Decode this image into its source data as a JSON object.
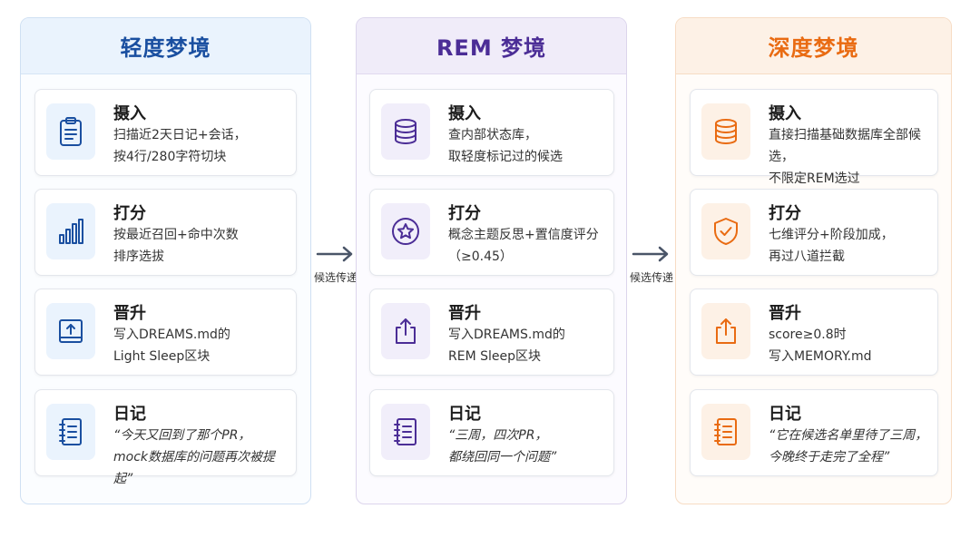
{
  "columns": [
    {
      "title": "轻度梦境",
      "color": "#1a4fa0",
      "cards": [
        {
          "title": "摄入",
          "desc": "扫描近2天日记+会话，\n按4行/280字符切块",
          "icon": "clipboard-icon"
        },
        {
          "title": "打分",
          "desc": "按最近召回+命中次数\n排序选拔",
          "icon": "bar-chart-icon"
        },
        {
          "title": "晋升",
          "desc": "写入DREAMS.md的\nLight Sleep区块",
          "icon": "upload-icon"
        },
        {
          "title": "日记",
          "desc": "“今天又回到了那个PR，\nmock数据库的问题再次被提起”",
          "icon": "notebook-icon"
        }
      ]
    },
    {
      "title": "REM 梦境",
      "color": "#4b2d96",
      "cards": [
        {
          "title": "摄入",
          "desc": "查内部状态库，\n取轻度标记过的候选",
          "icon": "database-icon"
        },
        {
          "title": "打分",
          "desc": "概念主题反思+置信度评分\n（≥0.45）",
          "icon": "star-icon"
        },
        {
          "title": "晋升",
          "desc": "写入DREAMS.md的\nREM Sleep区块",
          "icon": "share-icon"
        },
        {
          "title": "日记",
          "desc": "“三周，四次PR，\n都绕回同一个问题”",
          "icon": "notebook-icon"
        }
      ]
    },
    {
      "title": "深度梦境",
      "color": "#e96b12",
      "cards": [
        {
          "title": "摄入",
          "desc": "直接扫描基础数据库全部候选，\n不限定REM选过",
          "icon": "database-icon"
        },
        {
          "title": "打分",
          "desc": "七维评分+阶段加成，\n再过八道拦截",
          "icon": "shield-check-icon"
        },
        {
          "title": "晋升",
          "desc": "score≥0.8时\n写入MEMORY.md",
          "icon": "share-icon"
        },
        {
          "title": "日记",
          "desc": "“它在候选名单里待了三周，\n今晚终于走完了全程”",
          "icon": "notebook-icon"
        }
      ]
    }
  ],
  "arrows": [
    {
      "label": "候选传递"
    },
    {
      "label": "候选传递"
    }
  ]
}
